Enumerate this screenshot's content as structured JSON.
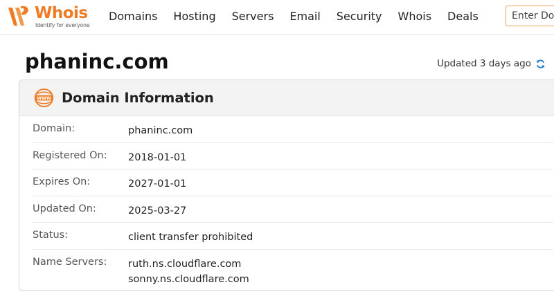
{
  "header": {
    "logo": {
      "word": "Whois",
      "tagline": "Identify for everyone"
    },
    "nav": [
      "Domains",
      "Hosting",
      "Servers",
      "Email",
      "Security",
      "Whois",
      "Deals"
    ],
    "search_placeholder": "Enter Domain"
  },
  "page": {
    "domain": "phaninc.com",
    "updated_text": "Updated 3 days ago"
  },
  "panel": {
    "title": "Domain Information",
    "icon": "www-icon",
    "rows": [
      {
        "label": "Domain:",
        "value": "phaninc.com"
      },
      {
        "label": "Registered On:",
        "value": "2018-01-01"
      },
      {
        "label": "Expires On:",
        "value": "2027-01-01"
      },
      {
        "label": "Updated On:",
        "value": "2025-03-27"
      },
      {
        "label": "Status:",
        "value": "client transfer prohibited"
      },
      {
        "label": "Name Servers:",
        "values": [
          "ruth.ns.cloudflare.com",
          "sonny.ns.cloudflare.com"
        ]
      }
    ]
  },
  "colors": {
    "brand": "#f07b22",
    "refresh": "#2f7fd1"
  }
}
